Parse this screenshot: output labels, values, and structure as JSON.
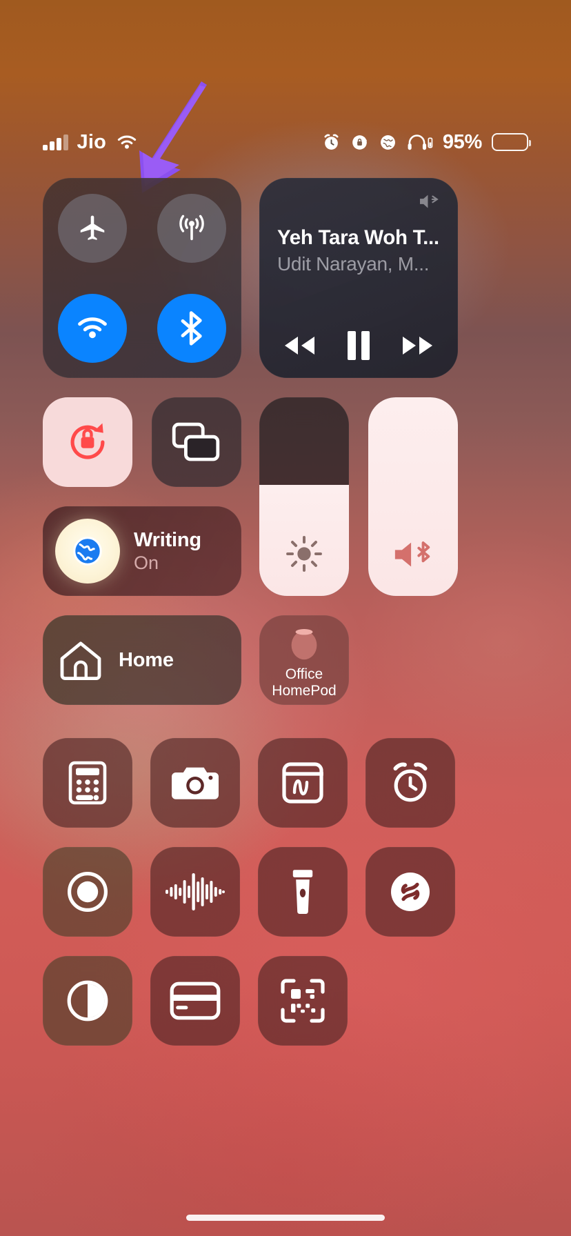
{
  "status_bar": {
    "carrier": "Jio",
    "signal_icon": "cellular-bars-icon",
    "wifi_icon": "wifi-icon",
    "right_icons": [
      "alarm-clock-icon",
      "rotation-lock-icon",
      "vpn-globe-icon",
      "headphones-battery-icon"
    ],
    "battery_percent": "95%",
    "battery_icon": "battery-icon"
  },
  "annotation": {
    "arrow_color": "#8B50F0",
    "points_to": "airplane-mode-toggle"
  },
  "control_center": {
    "connectivity": {
      "toggles": [
        {
          "name": "airplane-mode",
          "icon": "airplane-icon",
          "state": "off"
        },
        {
          "name": "cellular-data",
          "icon": "cellular-antenna-icon",
          "state": "off"
        },
        {
          "name": "wifi",
          "icon": "wifi-icon",
          "state": "on"
        },
        {
          "name": "bluetooth",
          "icon": "bluetooth-icon",
          "state": "on"
        }
      ],
      "on_color": "#0A84FF",
      "off_color": "#7C7C86"
    },
    "now_playing": {
      "title": "Yeh Tara Woh T...",
      "artist": "Udit Narayan, M...",
      "airplay_icon": "airplay-speaker-icon",
      "controls": [
        {
          "name": "rewind",
          "icon": "rewind-icon"
        },
        {
          "name": "pause",
          "icon": "pause-icon"
        },
        {
          "name": "fast-forward",
          "icon": "fast-forward-icon"
        }
      ]
    },
    "rotation_lock": {
      "icon": "rotation-lock-icon",
      "state": "on",
      "accent": "#FF4A4A"
    },
    "screen_mirroring": {
      "icon": "screen-mirroring-icon",
      "state": "off"
    },
    "focus": {
      "label": "Writing",
      "state": "On",
      "icon": "globe-icon"
    },
    "brightness": {
      "icon": "brightness-sun-icon",
      "level_percent": 56
    },
    "volume": {
      "icon": "volume-bluetooth-icon",
      "level_percent": 100
    },
    "home": {
      "label": "Home",
      "icon": "house-icon"
    },
    "homepod": {
      "label_line1": "Office",
      "label_line2": "HomePod",
      "icon": "homepod-icon"
    },
    "app_shortcuts": [
      {
        "name": "calculator",
        "icon": "calculator-icon"
      },
      {
        "name": "camera",
        "icon": "camera-icon"
      },
      {
        "name": "notes",
        "icon": "notes-icon"
      },
      {
        "name": "alarm",
        "icon": "alarm-clock-icon"
      },
      {
        "name": "screen-record",
        "icon": "screen-record-icon"
      },
      {
        "name": "voice-memos",
        "icon": "voice-memo-waveform-icon"
      },
      {
        "name": "flashlight",
        "icon": "flashlight-icon"
      },
      {
        "name": "shazam",
        "icon": "shazam-icon"
      },
      {
        "name": "dark-mode",
        "icon": "contrast-circle-icon"
      },
      {
        "name": "wallet",
        "icon": "wallet-icon"
      },
      {
        "name": "qr-code-scanner",
        "icon": "qr-code-icon"
      }
    ]
  }
}
